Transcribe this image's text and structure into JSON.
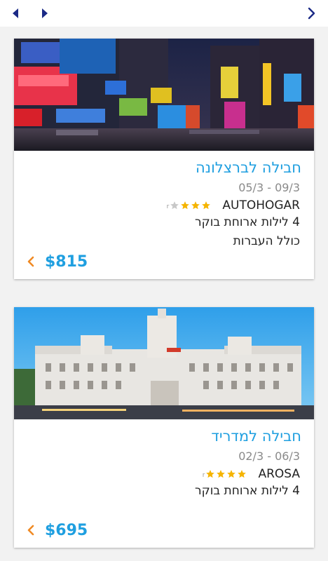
{
  "nav": {
    "prev_icon": "triangle-left-icon",
    "next_icon": "triangle-right-icon",
    "forward_icon": "chevron-right-icon"
  },
  "colors": {
    "accent": "#1f9fe0",
    "orange": "#f08a24",
    "star": "#f5b400",
    "star_empty": "#c8c8c8"
  },
  "cards": [
    {
      "title": "חבילה לברצלונה",
      "dates": "05/3 - 09/3",
      "hotel": "AUTOHOGAR",
      "stars": 3,
      "star_badge": "r",
      "nights_line": "4  לילות  ארוחת בוקר",
      "extra_line": "כולל העברות",
      "price": "$815",
      "image": "Times Square at night"
    },
    {
      "title": "חבילה למדריד",
      "dates": "02/3 - 06/3",
      "hotel": "AROSA",
      "stars": 4,
      "star_badge": "r",
      "nights_line": "4  לילות  ארוחת בוקר",
      "extra_line": "",
      "price": "$695",
      "image": "Palacio de Cibeles, Madrid"
    }
  ]
}
